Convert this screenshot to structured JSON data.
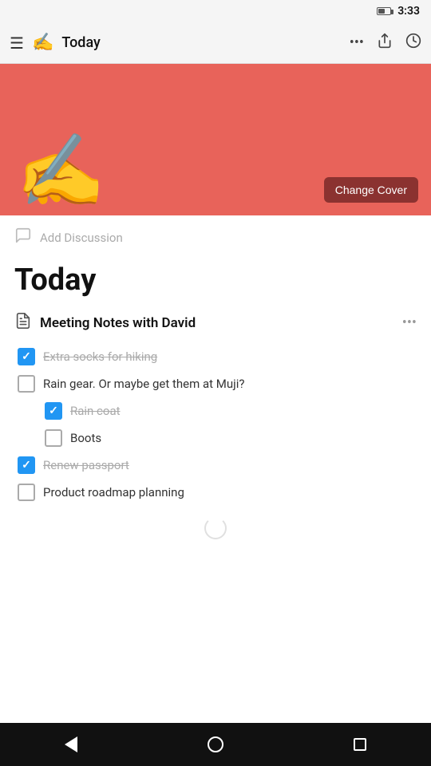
{
  "status_bar": {
    "time": "3:33",
    "battery_level": 50
  },
  "top_nav": {
    "title": "Today",
    "logo_emoji": "✍️",
    "menu_label": "☰",
    "more_label": "•••",
    "share_label": "⬆",
    "clock_label": "🕐"
  },
  "cover": {
    "bg_color": "#e8635a",
    "emoji": "✍️",
    "change_cover_label": "Change Cover"
  },
  "add_discussion": {
    "label": "Add Discussion"
  },
  "page_title": "Today",
  "note": {
    "icon": "📄",
    "title": "Meeting Notes with David",
    "menu": "•••"
  },
  "checklist": [
    {
      "id": "item1",
      "text": "Extra socks for hiking",
      "checked": true,
      "strikethrough": true,
      "indented": false
    },
    {
      "id": "item2",
      "text": "Rain gear. Or maybe get them at Muji?",
      "checked": false,
      "strikethrough": false,
      "indented": false
    },
    {
      "id": "item3",
      "text": "Rain coat",
      "checked": true,
      "strikethrough": true,
      "indented": true
    },
    {
      "id": "item4",
      "text": "Boots",
      "checked": false,
      "strikethrough": false,
      "indented": true
    },
    {
      "id": "item5",
      "text": "Renew passport",
      "checked": true,
      "strikethrough": true,
      "indented": false
    },
    {
      "id": "item6",
      "text": "Product roadmap planning",
      "checked": false,
      "strikethrough": false,
      "indented": false
    }
  ],
  "system_nav": {
    "back_label": "back",
    "home_label": "home",
    "recent_label": "recent"
  }
}
